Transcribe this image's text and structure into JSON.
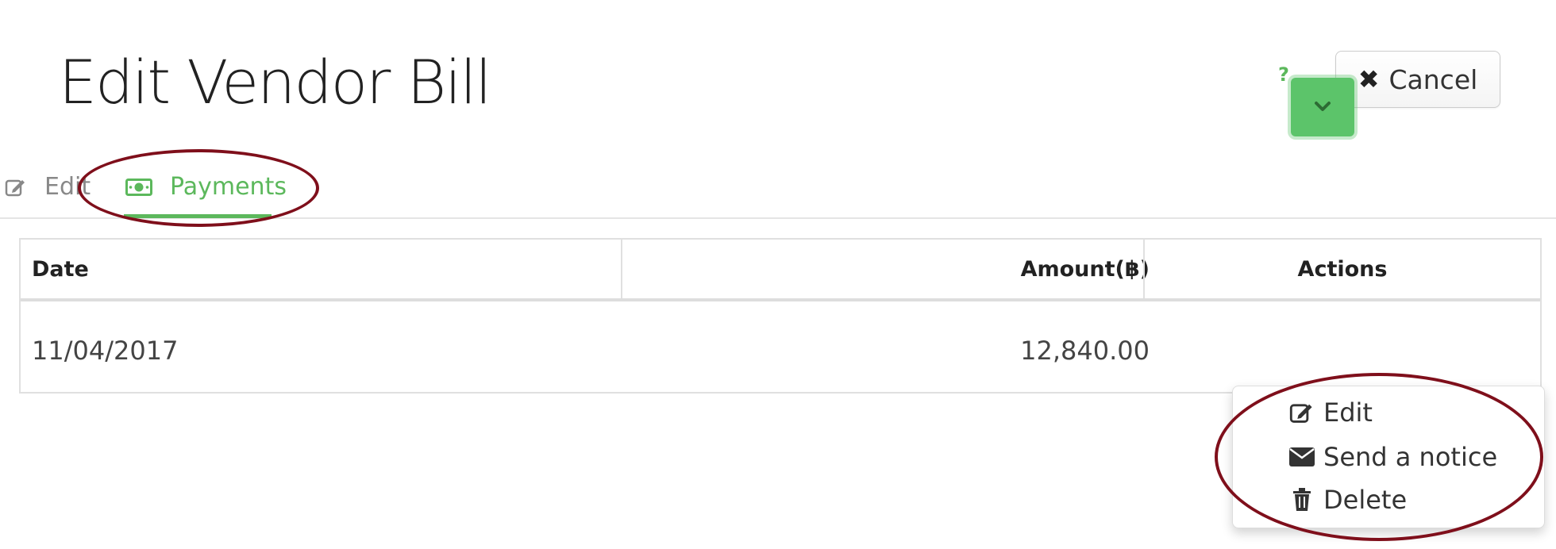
{
  "header": {
    "title": "Edit Vendor Bill",
    "help_label": "?",
    "cancel_label": "Cancel"
  },
  "tabs": [
    {
      "label": "Edit",
      "icon": "pencil-square-icon",
      "active": false
    },
    {
      "label": "Payments",
      "icon": "money-icon",
      "active": true
    }
  ],
  "table": {
    "columns": [
      "Date",
      "Amount(฿)",
      "Actions"
    ],
    "rows": [
      {
        "date": "11/04/2017",
        "amount": "12,840.00"
      }
    ]
  },
  "actions_menu": {
    "items": [
      {
        "label": "Edit",
        "icon": "pencil-square-icon"
      },
      {
        "label": "Send a notice",
        "icon": "envelope-icon"
      },
      {
        "label": "Delete",
        "icon": "trash-icon"
      }
    ]
  },
  "colors": {
    "accent": "#5cb85c",
    "annotation": "#7f0f1b"
  }
}
